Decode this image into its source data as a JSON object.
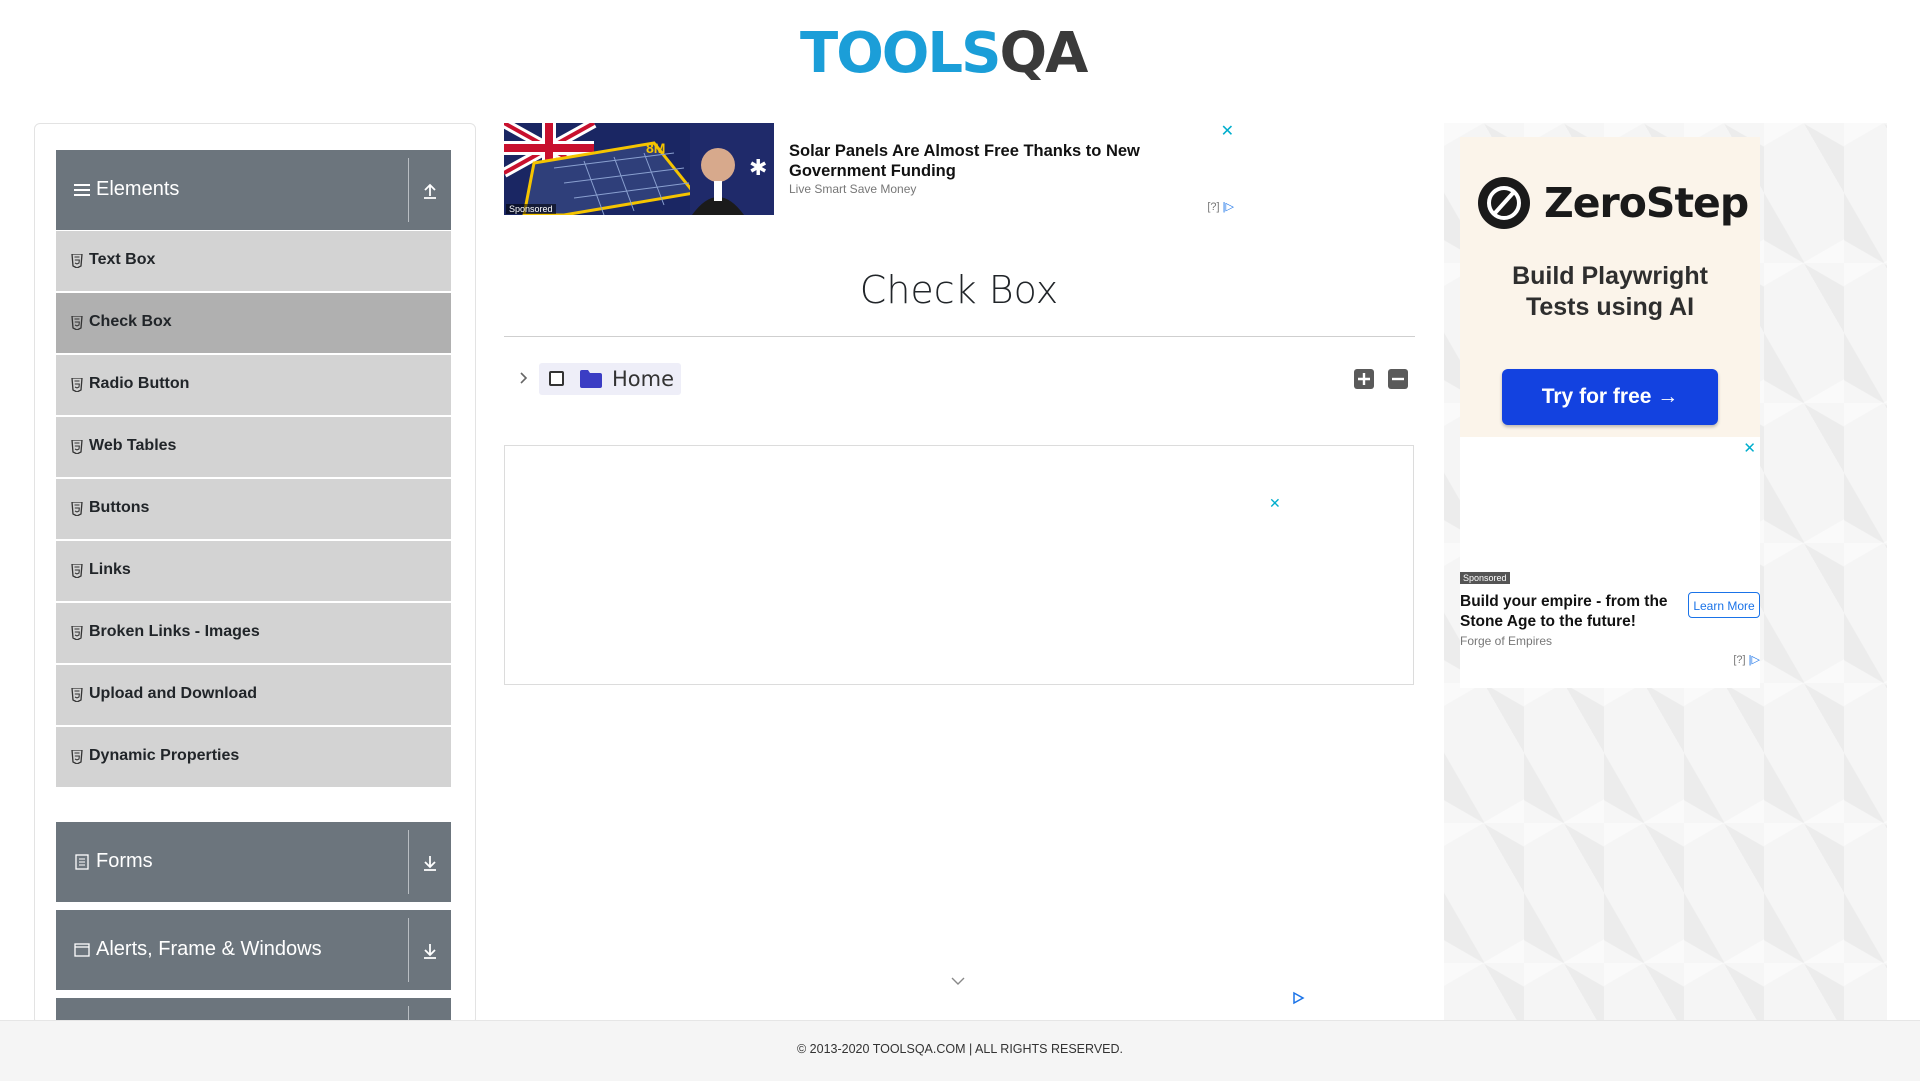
{
  "header": {
    "logo_part1": "TOOLS",
    "logo_part2": "QA"
  },
  "sidebar": {
    "groups": [
      {
        "title": "Elements",
        "icon": "hamburger-icon",
        "state": "expanded",
        "arrow_icon": "arrow-up-icon"
      },
      {
        "title": "Forms",
        "icon": "document-icon",
        "state": "collapsed",
        "arrow_icon": "arrow-down-icon"
      },
      {
        "title": "Alerts, Frame & Windows",
        "icon": "window-icon",
        "state": "collapsed",
        "arrow_icon": "arrow-down-icon"
      }
    ],
    "items": [
      {
        "label": "Text Box",
        "active": false
      },
      {
        "label": "Check Box",
        "active": true
      },
      {
        "label": "Radio Button",
        "active": false
      },
      {
        "label": "Web Tables",
        "active": false
      },
      {
        "label": "Buttons",
        "active": false
      },
      {
        "label": "Links",
        "active": false
      },
      {
        "label": "Broken Links - Images",
        "active": false
      },
      {
        "label": "Upload and Download",
        "active": false
      },
      {
        "label": "Dynamic Properties",
        "active": false
      }
    ],
    "item_icon": "html5-icon"
  },
  "top_ad": {
    "title": "Solar Panels Are Almost Free Thanks to New Government Funding",
    "source": "Live Smart Save Money",
    "image_badge": "8M",
    "sponsored": "Sponsored",
    "info": "[?]"
  },
  "main": {
    "title": "Check Box",
    "tree": {
      "node_label": "Home",
      "checked": false,
      "expanded": false
    }
  },
  "right_ads": {
    "zerostep": {
      "brand": "ZeroStep",
      "tagline_line1": "Build Playwright",
      "tagline_line2": "Tests using AI",
      "cta": "Try for free →"
    },
    "forge": {
      "sponsored": "Sponsored",
      "title": "Build your empire - from the Stone Age to the future!",
      "source": "Forge of Empires",
      "cta": "Learn More",
      "info": "[?]"
    }
  },
  "footer": {
    "text": "© 2013-2020 TOOLSQA.COM | ALL RIGHTS RESERVED."
  },
  "colors": {
    "logo_blue": "#1b9ed8",
    "group_header": "#6c757d",
    "menu_item": "#d3d3d3",
    "menu_item_active": "#b0b0b0",
    "folder": "#3b3dc4",
    "zerostep_button": "#1342e0"
  }
}
